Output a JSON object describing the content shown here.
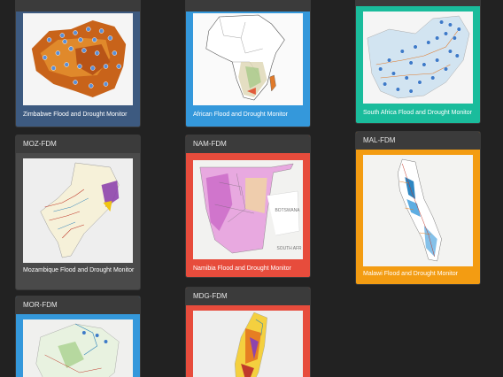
{
  "cards": {
    "zim": {
      "caption": "Zimbabwe Flood and Drought Monitor",
      "color": "#3d5a80"
    },
    "afr": {
      "caption": "African Flood and Drought Monitor",
      "color": "#3498db"
    },
    "saf": {
      "caption": "South Africa Flood and Drought Monitor",
      "color": "#1abc9c"
    },
    "moz": {
      "title": "MOZ-FDM",
      "caption": "Mozambique Flood and Drought Monitor",
      "color": "#4a4a4a"
    },
    "nam": {
      "title": "NAM-FDM",
      "caption": "Namibia Flood and Drought Monitor",
      "color": "#e74c3c",
      "map_labels": [
        "BOTSWANA",
        "SOUTH AFR"
      ]
    },
    "mal": {
      "title": "MAL-FDM",
      "caption": "Malawi Flood and Drought Monitor",
      "color": "#f39c12"
    },
    "mor": {
      "title": "MOR-FDM",
      "color": "#3498db"
    },
    "mdg": {
      "title": "MDG-FDM",
      "color": "#e74c3c"
    }
  }
}
